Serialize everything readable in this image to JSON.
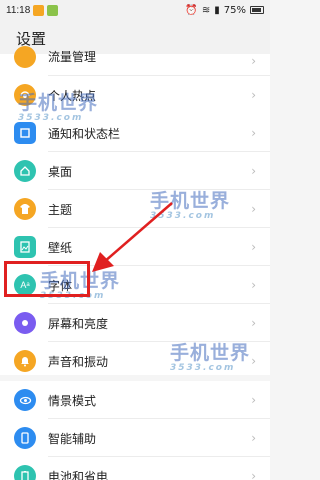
{
  "status_bar": {
    "time": "11:18",
    "battery": "75%"
  },
  "header": {
    "title": "设置"
  },
  "groups": [
    {
      "items": [
        {
          "label": "流量管理",
          "icon": "data-usage-icon",
          "color": "#f5a623"
        },
        {
          "label": "个人热点",
          "icon": "hotspot-icon",
          "color": "#f5a623"
        }
      ]
    },
    {
      "items": [
        {
          "label": "通知和状态栏",
          "icon": "notification-icon",
          "color": "#2d8cf0"
        },
        {
          "label": "桌面",
          "icon": "home-icon",
          "color": "#2ec3b0"
        },
        {
          "label": "主题",
          "icon": "shirt-icon",
          "color": "#f5a623"
        },
        {
          "label": "壁纸",
          "icon": "wallpaper-icon",
          "color": "#2ec3b0"
        },
        {
          "label": "字体",
          "icon": "font-icon",
          "color": "#2ec3b0"
        },
        {
          "label": "屏幕和亮度",
          "icon": "brightness-icon",
          "color": "#7a5cf0"
        },
        {
          "label": "声音和振动",
          "icon": "bell-icon",
          "color": "#f5a623"
        }
      ]
    },
    {
      "items": [
        {
          "label": "情景模式",
          "icon": "eye-icon",
          "color": "#2d8cf0"
        },
        {
          "label": "智能辅助",
          "icon": "assist-icon",
          "color": "#2d8cf0"
        },
        {
          "label": "电池和省电",
          "icon": "battery-icon",
          "color": "#2ec3b0"
        }
      ]
    }
  ],
  "watermark": {
    "text": "手机世界",
    "sub": "3533.com"
  }
}
